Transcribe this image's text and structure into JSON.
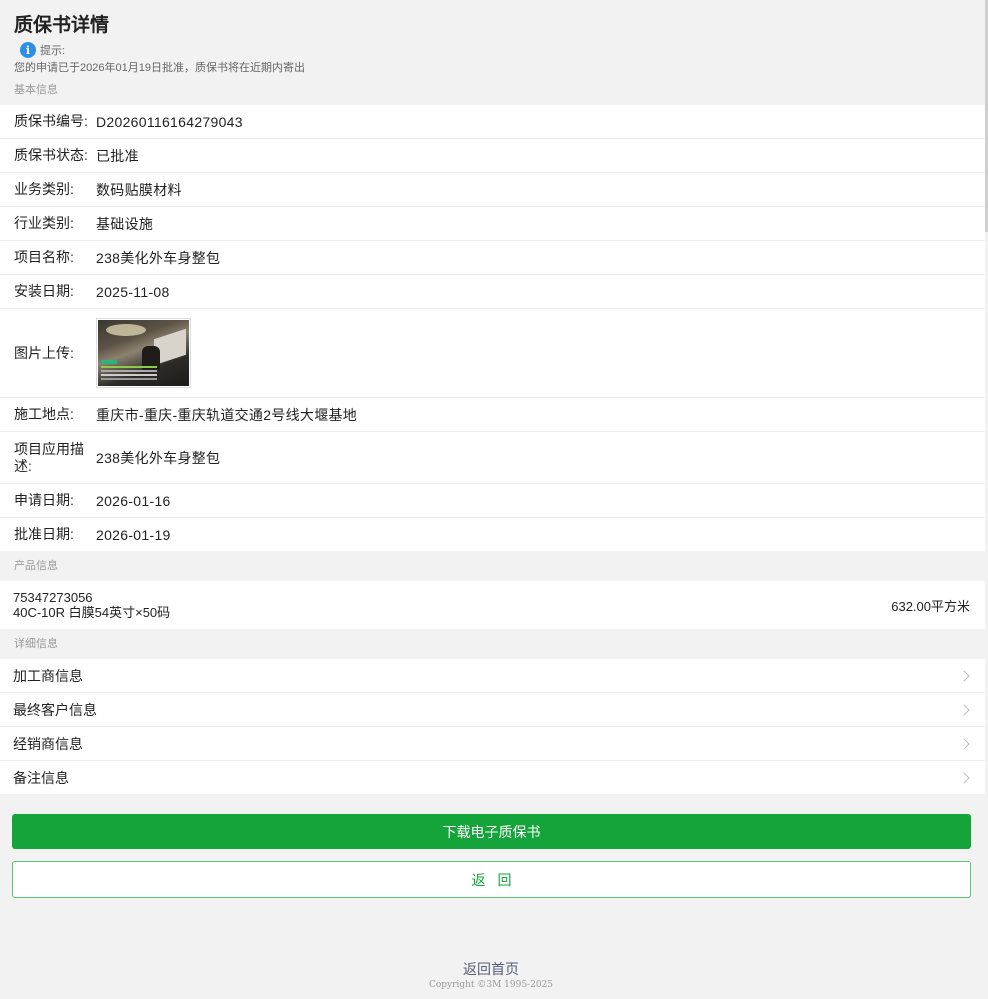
{
  "header": {
    "title": "质保书详情",
    "tip_label": "提示:",
    "tip_text": "您的申请已于2026年01月19日批准，质保书将在近期内寄出"
  },
  "basic": {
    "section_title": "基本信息",
    "rows": [
      {
        "label": "质保书编号:",
        "value": "D20260116164279043"
      },
      {
        "label": "质保书状态:",
        "value": "已批准"
      },
      {
        "label": "业务类别:",
        "value": "数码贴膜材料"
      },
      {
        "label": "行业类别:",
        "value": "基础设施"
      },
      {
        "label": "项目名称:",
        "value": "238美化外车身整包"
      },
      {
        "label": "安装日期:",
        "value": "2025-11-08"
      }
    ],
    "image_label": "图片上传:",
    "rows2": [
      {
        "label": "施工地点:",
        "value": "重庆市-重庆-重庆轨道交通2号线大堰基地"
      },
      {
        "label": "项目应用描述:",
        "value": "238美化外车身整包"
      },
      {
        "label": "申请日期:",
        "value": "2026-01-16"
      },
      {
        "label": "批准日期:",
        "value": "2026-01-19"
      }
    ]
  },
  "product": {
    "section_title": "产品信息",
    "code": "75347273056",
    "name": "40C-10R 白膜54英寸×50码",
    "qty": "632.00平方米"
  },
  "details": {
    "section_title": "详细信息",
    "items": [
      "加工商信息",
      "最终客户信息",
      "经销商信息",
      "备注信息"
    ]
  },
  "actions": {
    "download_label": "下载电子质保书",
    "back_label": "返回"
  },
  "footer": {
    "home_label": "返回首页",
    "copyright": "Copyright ©3M 1995-2025"
  },
  "icons": {
    "info": "info-icon",
    "chevron": "chevron-right-icon"
  },
  "colors": {
    "primary_green": "#14a43a",
    "info_blue": "#2f8fe6"
  }
}
